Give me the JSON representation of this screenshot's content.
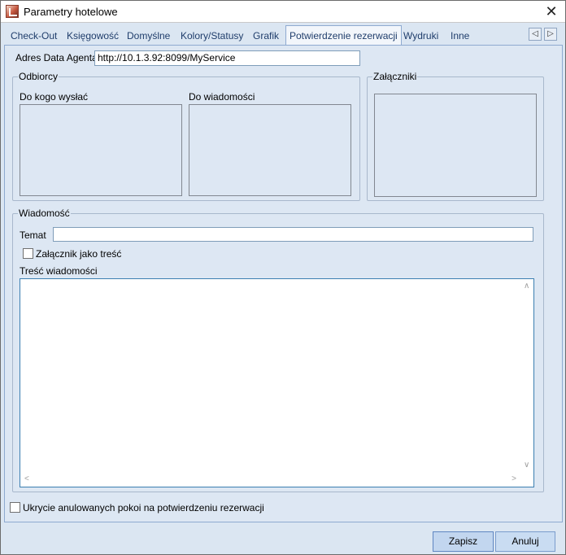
{
  "window": {
    "title": "Parametry hotelowe",
    "close_glyph": "✕"
  },
  "tabs": [
    {
      "label": "Check-Out"
    },
    {
      "label": "Księgowość"
    },
    {
      "label": "Domyślne"
    },
    {
      "label": "Kolory/Statusy"
    },
    {
      "label": "Grafik"
    },
    {
      "label": "Potwierdzenie rezerwacji",
      "active": true
    },
    {
      "label": "Wydruki"
    },
    {
      "label": "Inne"
    }
  ],
  "tab_nav": {
    "prev_glyph": "◁",
    "next_glyph": "▷"
  },
  "agent": {
    "label": "Adres Data Agenta",
    "value": "http://10.1.3.92:8099/MyService"
  },
  "recipients": {
    "title": "Odbiorcy",
    "to_label": "Do kogo wysłać",
    "cc_label": "Do wiadomości"
  },
  "attachments": {
    "title": "Załączniki"
  },
  "message": {
    "title": "Wiadomość",
    "subject_label": "Temat",
    "subject_value": "",
    "attachment_as_body_label": "Załącznik jako treść",
    "attachment_as_body_checked": false,
    "body_label": "Treść wiadomości",
    "body_value": ""
  },
  "hide_cancelled": {
    "label": "Ukrycie anulowanych pokoi na potwierdzeniu rezerwacji",
    "checked": false
  },
  "buttons": {
    "save_label": "Zapisz",
    "cancel_label": "Anuluj"
  }
}
